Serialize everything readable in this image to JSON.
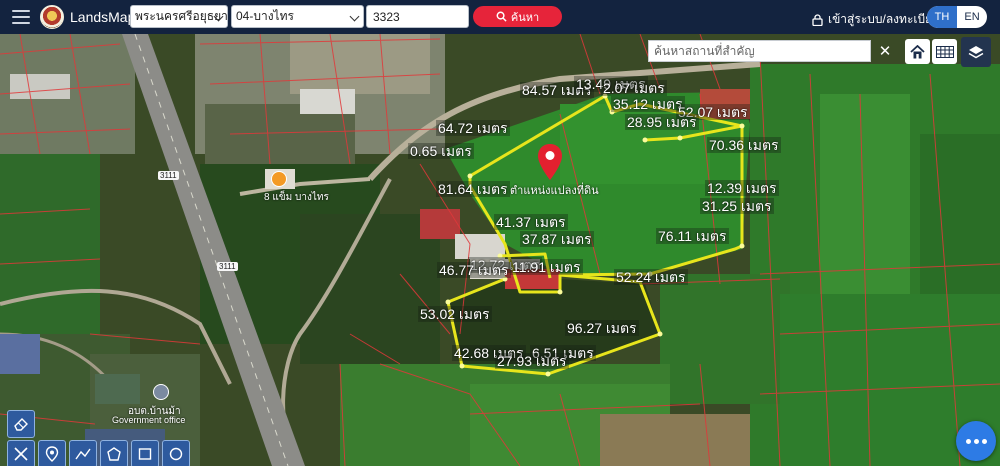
{
  "app": {
    "brand": "LandsMaps"
  },
  "search": {
    "province": "พระนครศรีอยุธยา",
    "district": "04-บางไทร",
    "parcel_number": "3323",
    "button_label": "ค้นหา"
  },
  "header": {
    "login_label": "เข้าสู่ระบบ/ลงทะเบียน",
    "lang_th": "TH",
    "lang_en": "EN"
  },
  "map_controls": {
    "place_search_placeholder": "ค้นหาสถานที่สำคัญ",
    "clear_symbol": "✕"
  },
  "parcel": {
    "pin_label": "ตำแหน่งแปลงที่ดิน",
    "distances": [
      "84.57 เมตร",
      "13.49 เมตร",
      "2.07 เมตร",
      "35.12 เมตร",
      "52.07 เมตร",
      "64.72 เมตร",
      "28.95 เมตร",
      "0.65 เมตร",
      "70.36 เมตร",
      "81.64 เมตร",
      "12.39 เมตร",
      "31.25 เมตร",
      "41.37 เมตร",
      "37.87 เมตร",
      "76.11 เมตร",
      "12.72 เมตร",
      "11.91 เมตร",
      "46.77 เมตร",
      "52.24 เมตร",
      "53.02 เมตร",
      "96.27 เมตร",
      "42.68 เมตร",
      "6.51 เมตร",
      "27.93 เมตร"
    ]
  },
  "map_labels": {
    "poi_shop": "8 แข็ม บางไทร",
    "road_1": "3111",
    "road_2": "3111",
    "gov_office_name": "อบต.บ้านม้า",
    "gov_office_type": "Government office"
  },
  "colors": {
    "topbar": "#13233f",
    "search_button": "#e6243a",
    "parcel_outline": "#e7e51c",
    "pin": "#e3202f",
    "lang_active": "#2f6fc9"
  }
}
